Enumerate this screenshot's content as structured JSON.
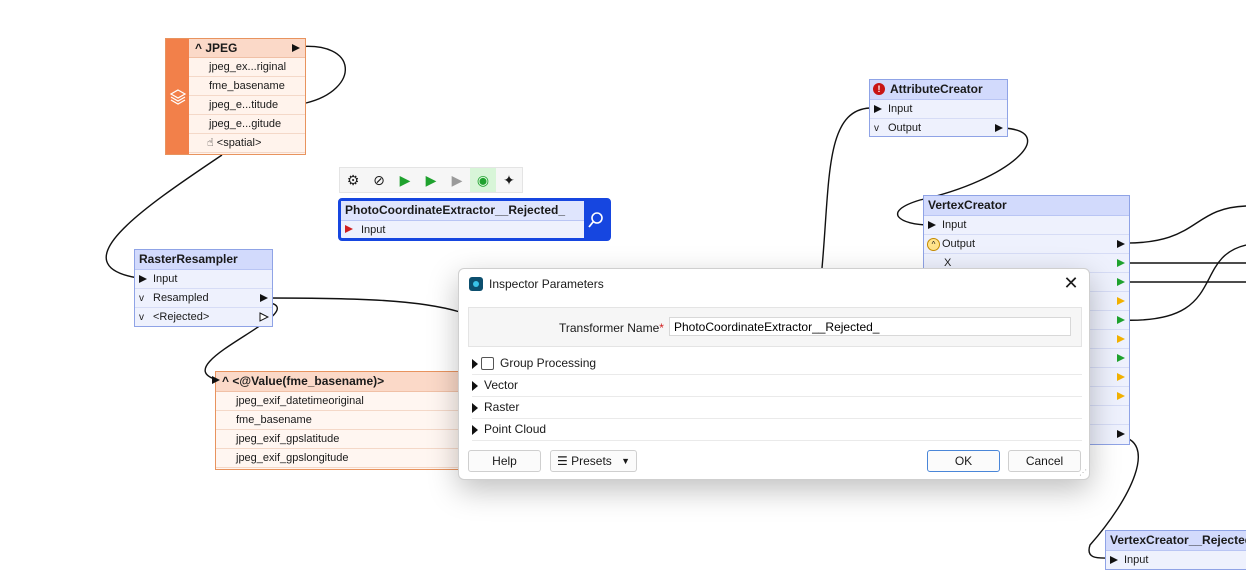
{
  "reader": {
    "title": "JPEG",
    "rows": [
      "jpeg_ex...riginal",
      "fme_basename",
      "jpeg_e...titude",
      "jpeg_e...gitude",
      "<spatial>"
    ]
  },
  "raster_resampler": {
    "title": "RasterResampler",
    "input": "Input",
    "output": "Resampled",
    "rejected": "<Rejected>"
  },
  "writer": {
    "title": "<@Value(fme_basename)>",
    "rows": [
      "jpeg_exif_datetimeoriginal",
      "fme_basename",
      "jpeg_exif_gpslatitude",
      "jpeg_exif_gpslongitude"
    ]
  },
  "selected_transformer": {
    "title": "PhotoCoordinateExtractor__Rejected_",
    "input": "Input"
  },
  "attribute_creator": {
    "title": "AttributeCreator",
    "input": "Input",
    "output": "Output"
  },
  "vertex_creator": {
    "title": "VertexCreator",
    "input": "Input",
    "output": "Output",
    "x": "X"
  },
  "vertex_rejected": {
    "title": "VertexCreator__Rejected",
    "input": "Input"
  },
  "dialog": {
    "title": "Inspector Parameters",
    "close": "✕",
    "name_label": "Transformer Name",
    "required_mark": "*",
    "name_value": "PhotoCoordinateExtractor__Rejected_",
    "sections": [
      "Group Processing",
      "Vector",
      "Raster",
      "Point Cloud"
    ],
    "help": "Help",
    "presets": "Presets",
    "ok": "OK",
    "cancel": "Cancel"
  },
  "colors": {
    "selection": "#1646e0",
    "reader": "#f2804a",
    "port_green": "#1fa22e",
    "port_yellow": "#f2b100"
  }
}
